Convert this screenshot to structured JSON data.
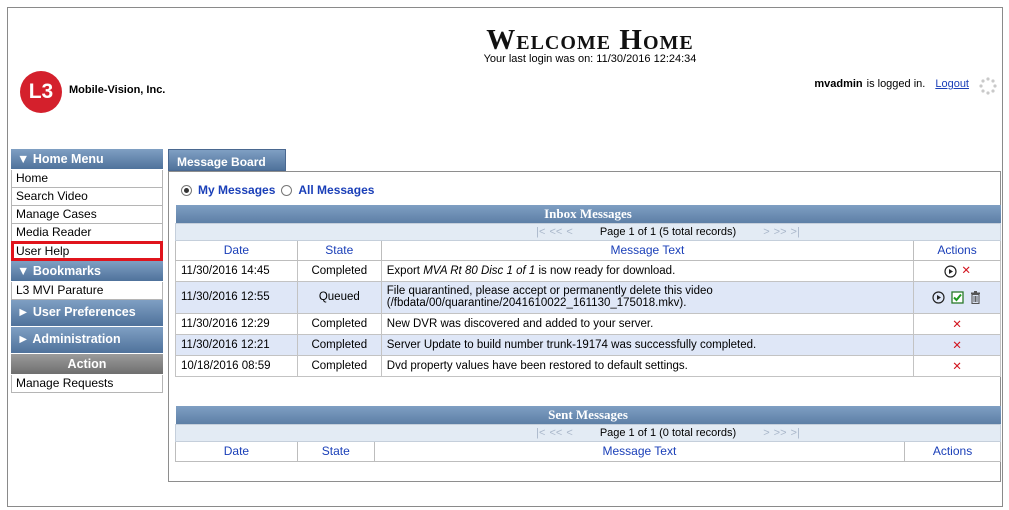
{
  "header": {
    "logo_text": "L3",
    "company": "Mobile-Vision, Inc.",
    "title": "Welcome Home",
    "last_login": "Your last login was on: 11/30/2016 12:24:34",
    "username": "mvadmin",
    "logged_in_text": "is logged in.",
    "logout": "Logout"
  },
  "menu": {
    "home_menu": "▼ Home Menu",
    "home_items": [
      "Home",
      "Search Video",
      "Manage Cases",
      "Media Reader",
      "User Help"
    ],
    "bookmarks": "▼ Bookmarks",
    "bookmark_items": [
      "L3 MVI Parature"
    ],
    "user_prefs": "► User Preferences",
    "administration": "► Administration",
    "action": "Action",
    "action_items": [
      "Manage Requests"
    ]
  },
  "tab": {
    "label": "Message Board"
  },
  "filters": {
    "my": "My Messages",
    "all": "All Messages"
  },
  "inbox": {
    "title": "Inbox Messages",
    "pager": "Page 1 of 1 (5 total records)",
    "columns": [
      "Date",
      "State",
      "Message Text",
      "Actions"
    ],
    "rows": [
      {
        "date": "11/30/2016 14:45",
        "state": "Completed",
        "text_pre": "Export ",
        "text_em": "MVA Rt 80 Disc 1 of 1",
        "text_post": " is now ready for download."
      },
      {
        "date": "11/30/2016 12:55",
        "state": "Queued",
        "text_line1": "File quarantined, please accept or permanently delete this video",
        "text_line2": "(/fbdata/00/quarantine/2041610022_161130_175018.mkv)."
      },
      {
        "date": "11/30/2016 12:29",
        "state": "Completed",
        "text": "New DVR was discovered and added to your server."
      },
      {
        "date": "11/30/2016 12:21",
        "state": "Completed",
        "text": "Server Update to build number trunk-19174 was successfully completed."
      },
      {
        "date": "10/18/2016 08:59",
        "state": "Completed",
        "text": "Dvd property values have been restored to default settings."
      }
    ]
  },
  "sent": {
    "title": "Sent Messages",
    "pager": "Page 1 of 1 (0 total records)",
    "columns": [
      "Date",
      "State",
      "Message Text",
      "Actions"
    ]
  },
  "colors": {
    "accent": "#4f729b",
    "link": "#1a3fb8",
    "delete": "#d2141e",
    "highlight": "#e0141c"
  }
}
